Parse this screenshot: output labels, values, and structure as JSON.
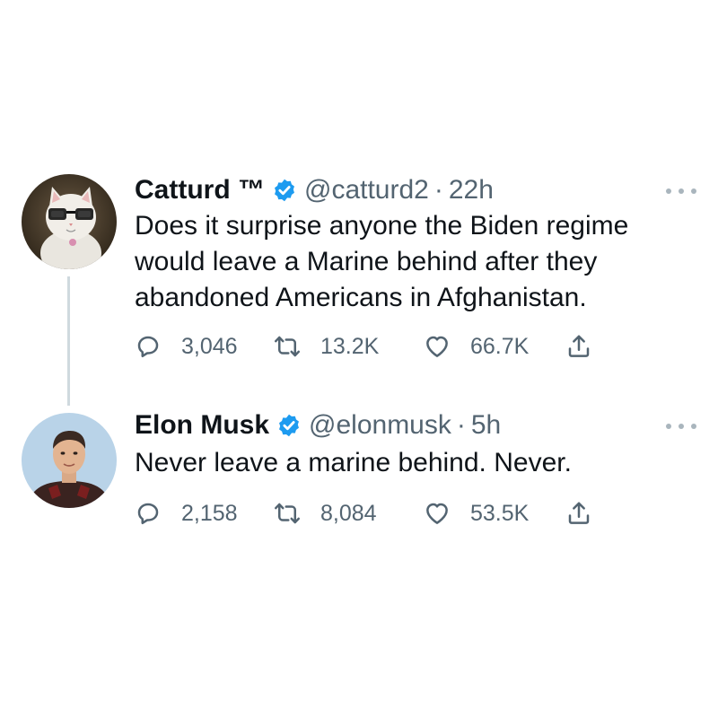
{
  "tweets": [
    {
      "display_name": "Catturd ™",
      "handle": "@catturd2",
      "separator": "·",
      "time": "22h",
      "text_lines": [
        "Does it surprise anyone the Biden regime",
        "would leave a Marine behind after they",
        "abandoned Americans in Afghanistan."
      ],
      "replies": "3,046",
      "retweets": "13.2K",
      "likes": "66.7K",
      "verified": true,
      "avatar_icon": "cat-with-glasses-avatar"
    },
    {
      "display_name": "Elon Musk",
      "handle": "@elonmusk",
      "separator": "·",
      "time": "5h",
      "text_lines": [
        "Never leave a marine behind. Never."
      ],
      "replies": "2,158",
      "retweets": "8,084",
      "likes": "53.5K",
      "verified": true,
      "avatar_icon": "person-portrait-avatar"
    }
  ],
  "icons": {
    "reply": "reply-icon",
    "retweet": "retweet-icon",
    "like": "heart-icon",
    "share": "share-icon",
    "verified": "verified-badge-icon",
    "more": "more-options-icon"
  },
  "colors": {
    "text_primary": "#0f1419",
    "text_secondary": "#536471",
    "verified_blue": "#1d9bf0",
    "thread_line": "#cfd9de",
    "background": "#ffffff"
  }
}
